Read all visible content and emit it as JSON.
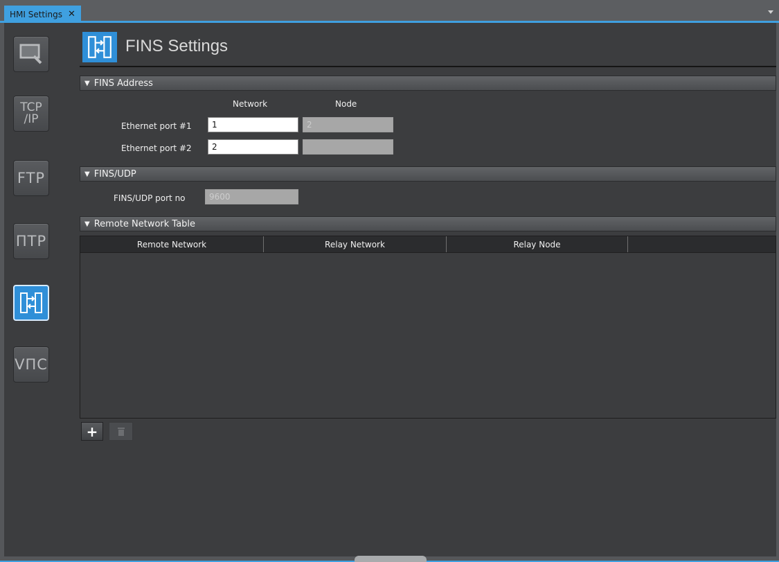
{
  "tab": {
    "label": "HMI Settings",
    "close": "✕"
  },
  "nav": {
    "tcp_label_line1": "TCP",
    "tcp_label_line2": "/IP",
    "ftp_label": "FTP",
    "ntp_label": "ПTP",
    "vnc_label": "VПC"
  },
  "header": {
    "title": "FINS Settings"
  },
  "fins_address": {
    "section_label": "FINS Address",
    "col_network": "Network",
    "col_node": "Node",
    "port1_label": "Ethernet port #1",
    "port1_network": "1",
    "port1_node": "2",
    "port2_label": "Ethernet port #2",
    "port2_network": "2",
    "port2_node": ""
  },
  "fins_udp": {
    "section_label": "FINS/UDP",
    "port_label": "FINS/UDP port no",
    "port_value": "9600"
  },
  "remote_table": {
    "section_label": "Remote Network Table",
    "headers": [
      "Remote Network",
      "Relay Network",
      "Relay Node"
    ],
    "rows": []
  },
  "colors": {
    "accent": "#3fa0e0",
    "active_nav": "#2f8fd8",
    "background": "#3c3d3f"
  }
}
